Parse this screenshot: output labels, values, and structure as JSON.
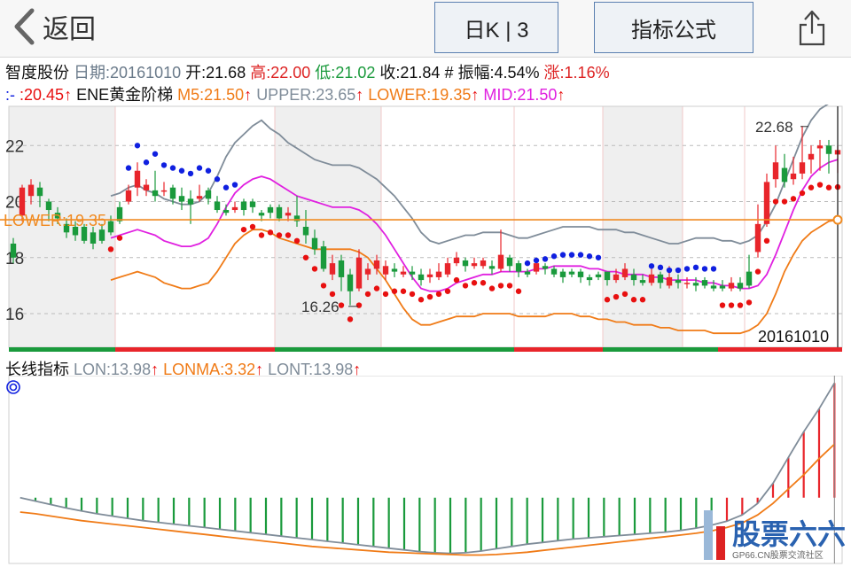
{
  "topbar": {
    "back_label": "返回",
    "period_label": "日K | 3",
    "indicator_label": "指标公式"
  },
  "stock": {
    "name": "智度股份",
    "date_label": "日期:",
    "date": "20161010",
    "open_label": "开:",
    "open": "21.68",
    "high_label": "高:",
    "high": "22.00",
    "low_label": "低:",
    "low": "21.02",
    "close_label": "收:",
    "close": "21.84",
    "amp_label": "# 振幅:",
    "amp": "4.54%",
    "chg_label": "涨:",
    "chg": "1.16%"
  },
  "ene": {
    "dot_label": ":-",
    "dot_value": ":20.45",
    "name": "ENE黄金阶梯",
    "m5_label": "M5:",
    "m5": "21.50",
    "upper_label": "UPPER:",
    "upper": "23.65",
    "lower_label": "LOWER:",
    "lower": "19.35",
    "mid_label": "MID:",
    "mid": "21.50",
    "arrow": "↑"
  },
  "lon": {
    "name": "长线指标",
    "lon_label": "LON:",
    "lon": "13.98",
    "lonma_label": "LONMA:",
    "lonma": "3.32",
    "lont_label": "LONT:",
    "lont": "13.98",
    "arrow": "↑"
  },
  "annotations": {
    "high_mark": "22.68",
    "low_mark": "16.26",
    "lower_tag": "LOWER:19.35",
    "cursor_date": "20161010"
  },
  "watermark": {
    "brand": "股票六六",
    "sub": "GP66.CN股票交流社区"
  },
  "colors": {
    "up": "#e8252b",
    "down": "#1a9a3c",
    "upper": "#7f8c99",
    "lower": "#f07b17",
    "mid": "#e020e0",
    "dot_blue": "#1020e0",
    "dot_red": "#e81010",
    "lower_line": "#f08a20"
  },
  "chart_data": [
    {
      "type": "candlestick",
      "title": "ENE黄金阶梯",
      "yticks": [
        16,
        18,
        20,
        22
      ],
      "ylim": [
        14.8,
        23.4
      ],
      "candles": [
        [
          18.5,
          18.0,
          18.7,
          17.8
        ],
        [
          19.5,
          20.5,
          20.6,
          19.3
        ],
        [
          20.2,
          20.6,
          20.8,
          19.9
        ],
        [
          20.5,
          20.2,
          20.7,
          19.8
        ],
        [
          20.0,
          19.7,
          20.1,
          19.3
        ],
        [
          19.6,
          19.4,
          19.8,
          19.2
        ],
        [
          19.2,
          18.9,
          19.4,
          18.7
        ],
        [
          19.1,
          18.8,
          19.3,
          18.6
        ],
        [
          19.1,
          18.6,
          19.2,
          18.5
        ],
        [
          18.9,
          18.5,
          19.1,
          18.3
        ],
        [
          19.0,
          18.6,
          19.2,
          18.5
        ],
        [
          19.3,
          18.9,
          19.5,
          18.8
        ],
        [
          19.8,
          19.3,
          20.0,
          19.2
        ],
        [
          20.0,
          20.4,
          20.6,
          19.9
        ],
        [
          20.5,
          21.1,
          21.4,
          20.2
        ],
        [
          20.4,
          20.6,
          20.8,
          20.2
        ],
        [
          20.4,
          20.2,
          21.1,
          20.0
        ],
        [
          20.4,
          20.4,
          20.7,
          20.2
        ],
        [
          20.5,
          20.1,
          20.6,
          19.9
        ],
        [
          20.2,
          20.0,
          20.5,
          19.7
        ],
        [
          20.1,
          19.9,
          20.4,
          19.2
        ],
        [
          20.1,
          20.2,
          20.6,
          20.0
        ],
        [
          20.4,
          20.1,
          20.5,
          19.9
        ],
        [
          20.0,
          19.7,
          20.2,
          19.6
        ],
        [
          19.7,
          19.6,
          19.9,
          19.5
        ],
        [
          19.7,
          19.8,
          20.0,
          19.6
        ],
        [
          20.0,
          19.7,
          20.1,
          19.5
        ],
        [
          20.0,
          19.8,
          20.1,
          19.6
        ],
        [
          19.6,
          19.5,
          19.7,
          19.3
        ],
        [
          19.8,
          19.6,
          19.9,
          19.4
        ],
        [
          19.8,
          19.4,
          19.9,
          19.3
        ],
        [
          19.5,
          19.6,
          19.8,
          19.3
        ],
        [
          19.5,
          19.3,
          20.2,
          19.1
        ],
        [
          19.1,
          18.8,
          19.7,
          18.5
        ],
        [
          18.7,
          18.3,
          19.0,
          18.1
        ],
        [
          18.4,
          17.6,
          18.6,
          17.5
        ],
        [
          17.4,
          17.8,
          18.1,
          17.2
        ],
        [
          17.9,
          17.3,
          18.1,
          16.8
        ],
        [
          17.4,
          16.8,
          17.6,
          16.3
        ],
        [
          16.9,
          18.0,
          18.3,
          16.8
        ],
        [
          17.4,
          17.6,
          17.8,
          17.2
        ],
        [
          17.6,
          17.9,
          18.1,
          17.4
        ],
        [
          17.4,
          17.7,
          17.9,
          17.2
        ],
        [
          17.6,
          17.5,
          17.8,
          17.3
        ],
        [
          17.4,
          17.5,
          17.7,
          17.3
        ],
        [
          17.5,
          17.4,
          17.7,
          17.2
        ],
        [
          17.4,
          17.2,
          17.6,
          17.0
        ],
        [
          17.3,
          17.4,
          17.6,
          17.1
        ],
        [
          17.3,
          17.5,
          17.8,
          17.2
        ],
        [
          17.4,
          17.8,
          18.0,
          17.3
        ],
        [
          17.8,
          18.0,
          18.2,
          17.7
        ],
        [
          17.9,
          17.7,
          18.0,
          17.5
        ],
        [
          17.7,
          17.8,
          18.0,
          17.6
        ],
        [
          17.7,
          17.9,
          18.0,
          17.6
        ],
        [
          17.7,
          17.6,
          17.9,
          17.4
        ],
        [
          17.6,
          18.1,
          19.0,
          17.5
        ],
        [
          18.0,
          17.7,
          18.1,
          17.5
        ],
        [
          17.8,
          17.5,
          17.9,
          17.3
        ],
        [
          17.5,
          17.4,
          17.6,
          17.3
        ],
        [
          17.5,
          17.8,
          17.9,
          17.4
        ],
        [
          17.7,
          17.6,
          17.8,
          17.4
        ],
        [
          17.6,
          17.4,
          17.7,
          17.3
        ],
        [
          17.5,
          17.3,
          17.6,
          17.1
        ],
        [
          17.5,
          17.4,
          17.6,
          17.3
        ],
        [
          17.5,
          17.3,
          17.6,
          17.1
        ],
        [
          17.3,
          17.2,
          17.4,
          17.0
        ],
        [
          17.4,
          17.3,
          17.5,
          17.2
        ],
        [
          17.5,
          17.2,
          17.5,
          17.0
        ],
        [
          17.2,
          17.4,
          17.6,
          17.1
        ],
        [
          17.3,
          17.6,
          17.8,
          17.2
        ],
        [
          17.4,
          17.2,
          17.6,
          17.0
        ],
        [
          17.2,
          17.1,
          17.4,
          17.0
        ],
        [
          17.1,
          17.4,
          17.6,
          17.0
        ],
        [
          17.4,
          17.1,
          17.5,
          16.9
        ],
        [
          17.0,
          17.3,
          17.7,
          16.9
        ],
        [
          17.2,
          17.1,
          17.4,
          16.9
        ],
        [
          17.1,
          17.1,
          17.3,
          16.9
        ],
        [
          17.1,
          17.0,
          17.3,
          16.8
        ],
        [
          17.2,
          17.0,
          17.3,
          16.9
        ],
        [
          17.0,
          16.9,
          17.2,
          16.8
        ],
        [
          17.0,
          16.9,
          17.2,
          16.8
        ],
        [
          16.9,
          17.1,
          17.3,
          16.8
        ],
        [
          17.1,
          16.9,
          17.3,
          16.8
        ],
        [
          17.5,
          17.0,
          18.1,
          16.9
        ],
        [
          18.2,
          19.2,
          19.9,
          18.0
        ],
        [
          19.2,
          20.7,
          21.0,
          19.1
        ],
        [
          20.8,
          21.4,
          22.0,
          20.5
        ],
        [
          21.2,
          20.7,
          21.7,
          20.5
        ],
        [
          20.8,
          21.0,
          21.6,
          20.6
        ],
        [
          21.0,
          21.4,
          22.7,
          20.8
        ],
        [
          21.5,
          21.7,
          22.0,
          21.0
        ],
        [
          21.9,
          22.0,
          22.2,
          21.1
        ],
        [
          22.0,
          21.7,
          22.2,
          21.0
        ],
        [
          21.68,
          21.84,
          22.0,
          21.02
        ]
      ],
      "series": [
        {
          "name": "UPPER",
          "values": [
            20.2,
            20.3,
            20.5,
            20.6,
            20.4,
            20.3,
            20.1,
            20.0,
            19.9,
            19.9,
            20.0,
            20.3,
            20.9,
            21.6,
            22.1,
            22.4,
            22.7,
            22.9,
            22.6,
            22.4,
            22.1,
            21.9,
            21.7,
            21.5,
            21.4,
            21.3,
            21.3,
            21.3,
            21.2,
            21.0,
            20.8,
            20.5,
            20.2,
            19.8,
            19.4,
            18.9,
            18.6,
            18.5,
            18.6,
            18.7,
            18.8,
            18.8,
            18.9,
            18.9,
            18.9,
            18.8,
            18.7,
            18.7,
            18.8,
            18.9,
            19.0,
            19.1,
            19.1,
            19.1,
            19.1,
            19.0,
            19.0,
            19.0,
            18.9,
            18.9,
            18.8,
            18.7,
            18.6,
            18.5,
            18.5,
            18.6,
            18.7,
            18.7,
            18.7,
            18.6,
            18.6,
            18.5,
            18.6,
            18.8,
            19.3,
            19.9,
            20.7,
            21.5,
            22.3,
            22.9,
            23.3,
            23.5,
            23.65
          ]
        },
        {
          "name": "MID",
          "values": [
            18.7,
            18.8,
            18.9,
            19.0,
            18.9,
            18.8,
            18.6,
            18.5,
            18.4,
            18.4,
            18.5,
            18.7,
            19.2,
            19.8,
            20.3,
            20.6,
            20.8,
            20.9,
            20.8,
            20.6,
            20.4,
            20.2,
            20.1,
            20.0,
            19.9,
            19.8,
            19.8,
            19.8,
            19.7,
            19.5,
            19.2,
            18.8,
            18.3,
            17.8,
            17.3,
            16.9,
            16.8,
            16.8,
            16.9,
            17.1,
            17.2,
            17.3,
            17.4,
            17.4,
            17.5,
            17.5,
            17.5,
            17.5,
            17.6,
            17.6,
            17.7,
            17.7,
            17.7,
            17.7,
            17.6,
            17.6,
            17.5,
            17.5,
            17.4,
            17.4,
            17.4,
            17.3,
            17.3,
            17.2,
            17.2,
            17.2,
            17.2,
            17.1,
            17.1,
            17.0,
            17.0,
            16.9,
            16.9,
            17.0,
            17.4,
            18.1,
            18.9,
            19.7,
            20.4,
            20.9,
            21.2,
            21.4,
            21.5
          ]
        },
        {
          "name": "LOWER",
          "values": [
            17.2,
            17.3,
            17.4,
            17.5,
            17.4,
            17.3,
            17.1,
            17.0,
            16.9,
            16.9,
            17.0,
            17.1,
            17.5,
            18.0,
            18.5,
            18.8,
            19.0,
            19.0,
            18.9,
            18.7,
            18.6,
            18.5,
            18.4,
            18.3,
            18.3,
            18.3,
            18.3,
            18.3,
            18.2,
            18.0,
            17.6,
            17.2,
            16.7,
            16.2,
            15.8,
            15.6,
            15.6,
            15.7,
            15.8,
            15.9,
            15.9,
            15.9,
            16.0,
            16.0,
            16.0,
            16.0,
            15.9,
            15.9,
            15.9,
            15.9,
            16.0,
            16.0,
            16.0,
            15.9,
            15.9,
            15.8,
            15.8,
            15.7,
            15.7,
            15.6,
            15.6,
            15.6,
            15.5,
            15.5,
            15.4,
            15.4,
            15.4,
            15.4,
            15.3,
            15.3,
            15.3,
            15.3,
            15.4,
            15.6,
            16.0,
            16.7,
            17.5,
            18.1,
            18.6,
            18.9,
            19.1,
            19.3,
            19.35
          ]
        }
      ],
      "markers": {
        "high": 22.68,
        "low": 16.26,
        "lower_line": 19.35
      }
    },
    {
      "type": "bar",
      "title": "长线指标",
      "series": [
        {
          "name": "LON",
          "values": [
            -6.0,
            -6.6,
            -7.2,
            -7.8,
            -8.3,
            -8.8,
            -9.2,
            -9.6,
            -10.0,
            -10.3,
            -10.6,
            -10.9,
            -11.2,
            -11.5,
            -11.8,
            -12.1,
            -12.4,
            -12.7,
            -13.0,
            -13.3,
            -13.6,
            -13.9,
            -14.2,
            -14.5,
            -14.8,
            -15.1,
            -15.4,
            -15.6,
            -15.7,
            -15.6,
            -15.3,
            -14.9,
            -14.5,
            -14.1,
            -13.8,
            -13.5,
            -13.2,
            -13.0,
            -12.8,
            -12.6,
            -12.4,
            -12.2,
            -12.0,
            -11.7,
            -11.3,
            -10.8,
            -10.1,
            -9.0,
            -7.0,
            -3.5,
            1.0,
            5.5,
            9.5,
            13.98
          ]
        },
        {
          "name": "LONMA",
          "values": [
            -8.5,
            -8.8,
            -9.2,
            -9.6,
            -10.0,
            -10.3,
            -10.6,
            -10.9,
            -11.2,
            -11.5,
            -11.8,
            -12.1,
            -12.4,
            -12.7,
            -13.0,
            -13.3,
            -13.6,
            -13.9,
            -14.2,
            -14.5,
            -14.7,
            -14.9,
            -15.1,
            -15.3,
            -15.5,
            -15.6,
            -15.7,
            -15.8,
            -15.9,
            -16.0,
            -16.0,
            -15.9,
            -15.7,
            -15.5,
            -15.2,
            -14.9,
            -14.6,
            -14.3,
            -14.0,
            -13.7,
            -13.4,
            -13.1,
            -12.8,
            -12.5,
            -12.2,
            -11.8,
            -11.2,
            -10.4,
            -9.0,
            -7.0,
            -4.5,
            -2.0,
            0.8,
            3.32
          ]
        }
      ]
    }
  ]
}
